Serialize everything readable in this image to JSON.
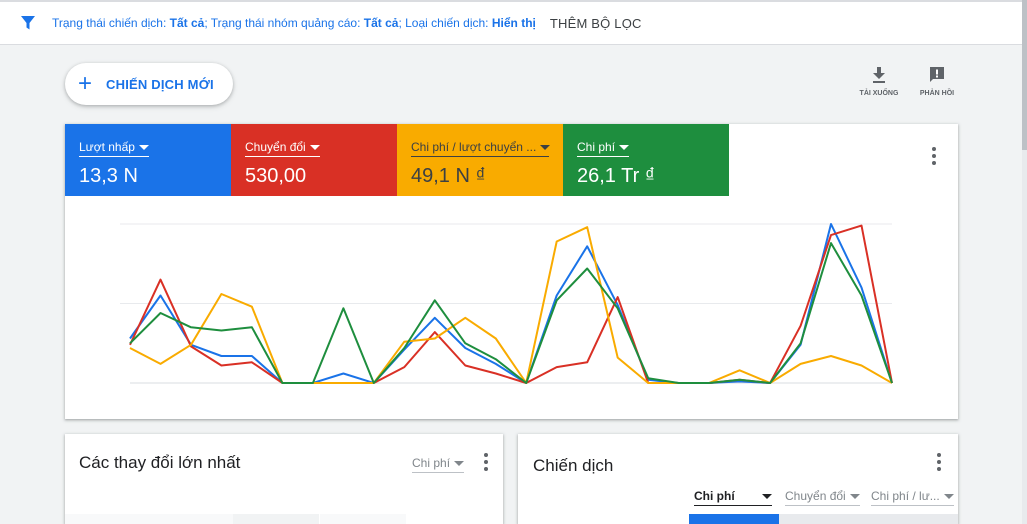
{
  "filter_bar": {
    "label1": "Trạng thái chiến dịch: ",
    "value1": "Tất cả",
    "label2": "; Trạng thái nhóm quảng cáo: ",
    "value2": "Tất cả",
    "label3": "; Loại chiến dịch: ",
    "value3": "Hiển thị",
    "add_filter": "THÊM BỘ LỌC"
  },
  "toolbar": {
    "new_campaign": "CHIẾN DỊCH MỚI",
    "download": "TẢI XUỐNG",
    "feedback": "PHẢN HỒI"
  },
  "metrics": [
    {
      "name": "Lượt nhấp",
      "value": "13,3 N",
      "color": "#1a73e8"
    },
    {
      "name": "Chuyển đổi",
      "value": "530,00",
      "color": "#d93025"
    },
    {
      "name": "Chi phí / lượt chuyển ...",
      "value": "49,1 N ₫",
      "color": "#f9ab00"
    },
    {
      "name": "Chi phí",
      "value": "26,1 Tr ₫",
      "color": "#1e8e3e"
    }
  ],
  "chart_data": {
    "type": "line",
    "grid": true,
    "legend": "none",
    "x": [
      0,
      1,
      2,
      3,
      4,
      5,
      6,
      7,
      8,
      9,
      10,
      11,
      12,
      13,
      14,
      15,
      16,
      17,
      18,
      19,
      20,
      21,
      22,
      23,
      24,
      25
    ],
    "series": [
      {
        "color": "#1a73e8",
        "values": [
          0.28,
          0.55,
          0.24,
          0.17,
          0.17,
          0,
          0,
          0.06,
          0,
          0.21,
          0.41,
          0.22,
          0.12,
          0,
          0.55,
          0.86,
          0.49,
          0.02,
          0,
          0,
          0.01,
          0,
          0.24,
          1.0,
          0.6,
          0
        ]
      },
      {
        "color": "#d93025",
        "values": [
          0.24,
          0.65,
          0.23,
          0.11,
          0.13,
          0,
          0,
          0,
          0,
          0.1,
          0.32,
          0.11,
          0.06,
          0,
          0.1,
          0.13,
          0.54,
          0,
          0,
          0,
          0.02,
          0,
          0.36,
          0.93,
          0.99,
          0
        ]
      },
      {
        "color": "#f9ab00",
        "values": [
          0.22,
          0.12,
          0.24,
          0.56,
          0.48,
          0,
          0,
          0,
          0,
          0.26,
          0.28,
          0.41,
          0.28,
          0,
          0.89,
          0.98,
          0.16,
          0,
          0,
          0,
          0.08,
          0,
          0.12,
          0.17,
          0.11,
          0
        ]
      },
      {
        "color": "#1e8e3e",
        "values": [
          0.25,
          0.44,
          0.35,
          0.33,
          0.35,
          0,
          0,
          0.47,
          0,
          0.22,
          0.52,
          0.25,
          0.15,
          0,
          0.52,
          0.72,
          0.47,
          0.03,
          0,
          0,
          0.02,
          0,
          0.25,
          0.88,
          0.55,
          0
        ]
      }
    ]
  },
  "card_changes": {
    "title": "Các thay đổi lớn nhất",
    "select": "Chi phí"
  },
  "card_campaigns": {
    "title": "Chiến dịch",
    "col1": "Chi phí",
    "col2": "Chuyển đổi",
    "col3": "Chi phí / lư..."
  }
}
